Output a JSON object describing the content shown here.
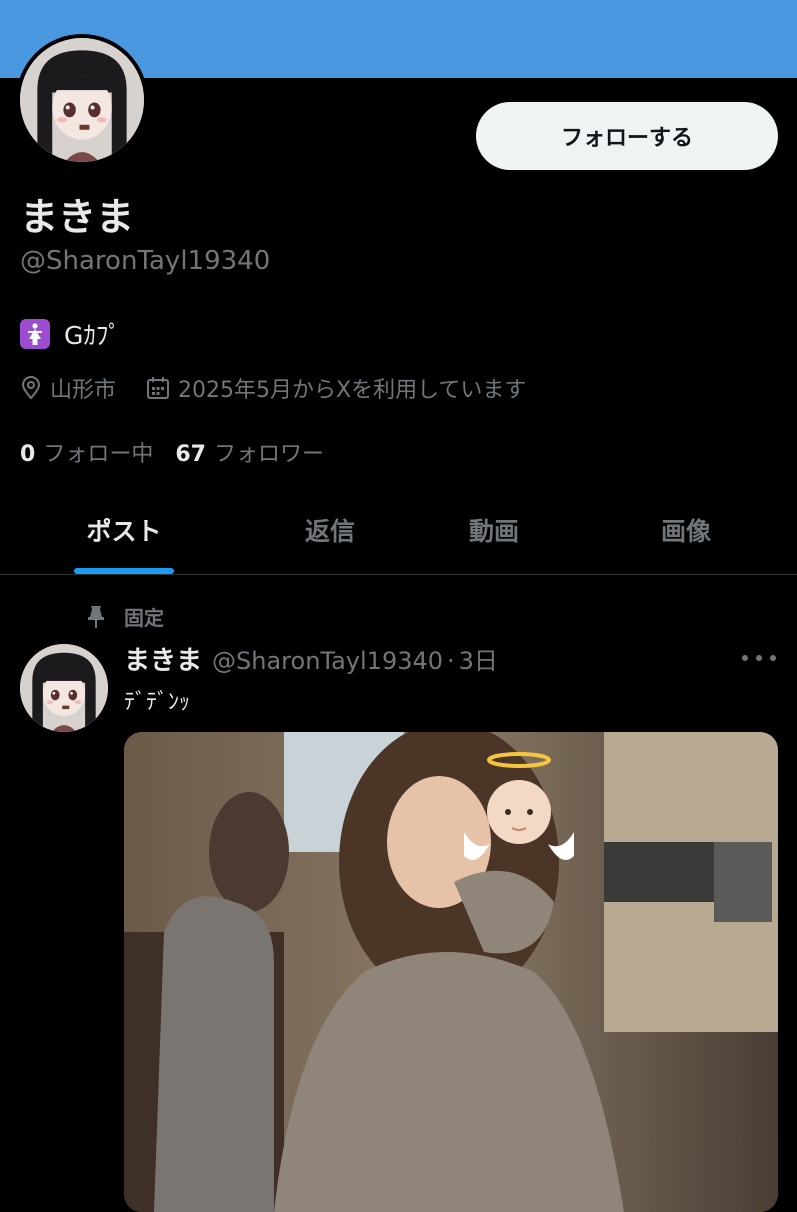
{
  "profile": {
    "display_name": "まきま",
    "handle": "@SharonTayl19340",
    "follow_label": "フォローする",
    "bio_text": "Gｶﾌﾟ",
    "bio_emoji": "woman-restroom-icon",
    "location": "山形市",
    "joined": "2025年5月からXを利用しています",
    "following_count": "0",
    "following_label": "フォロー中",
    "followers_count": "67",
    "followers_label": "フォロワー"
  },
  "tabs": [
    {
      "label": "ポスト",
      "active": true
    },
    {
      "label": "返信",
      "active": false
    },
    {
      "label": "動画",
      "active": false
    },
    {
      "label": "画像",
      "active": false
    }
  ],
  "post": {
    "pinned_label": "固定",
    "author_name": "まきま",
    "author_handle": "@SharonTayl19340",
    "separator": "·",
    "timestamp": "3日",
    "text": "ﾃﾞﾃﾞﾝｯ"
  },
  "colors": {
    "banner": "#4a99e0",
    "accent": "#1d9bf0",
    "bio_emoji_bg": "#9c4ccf"
  }
}
